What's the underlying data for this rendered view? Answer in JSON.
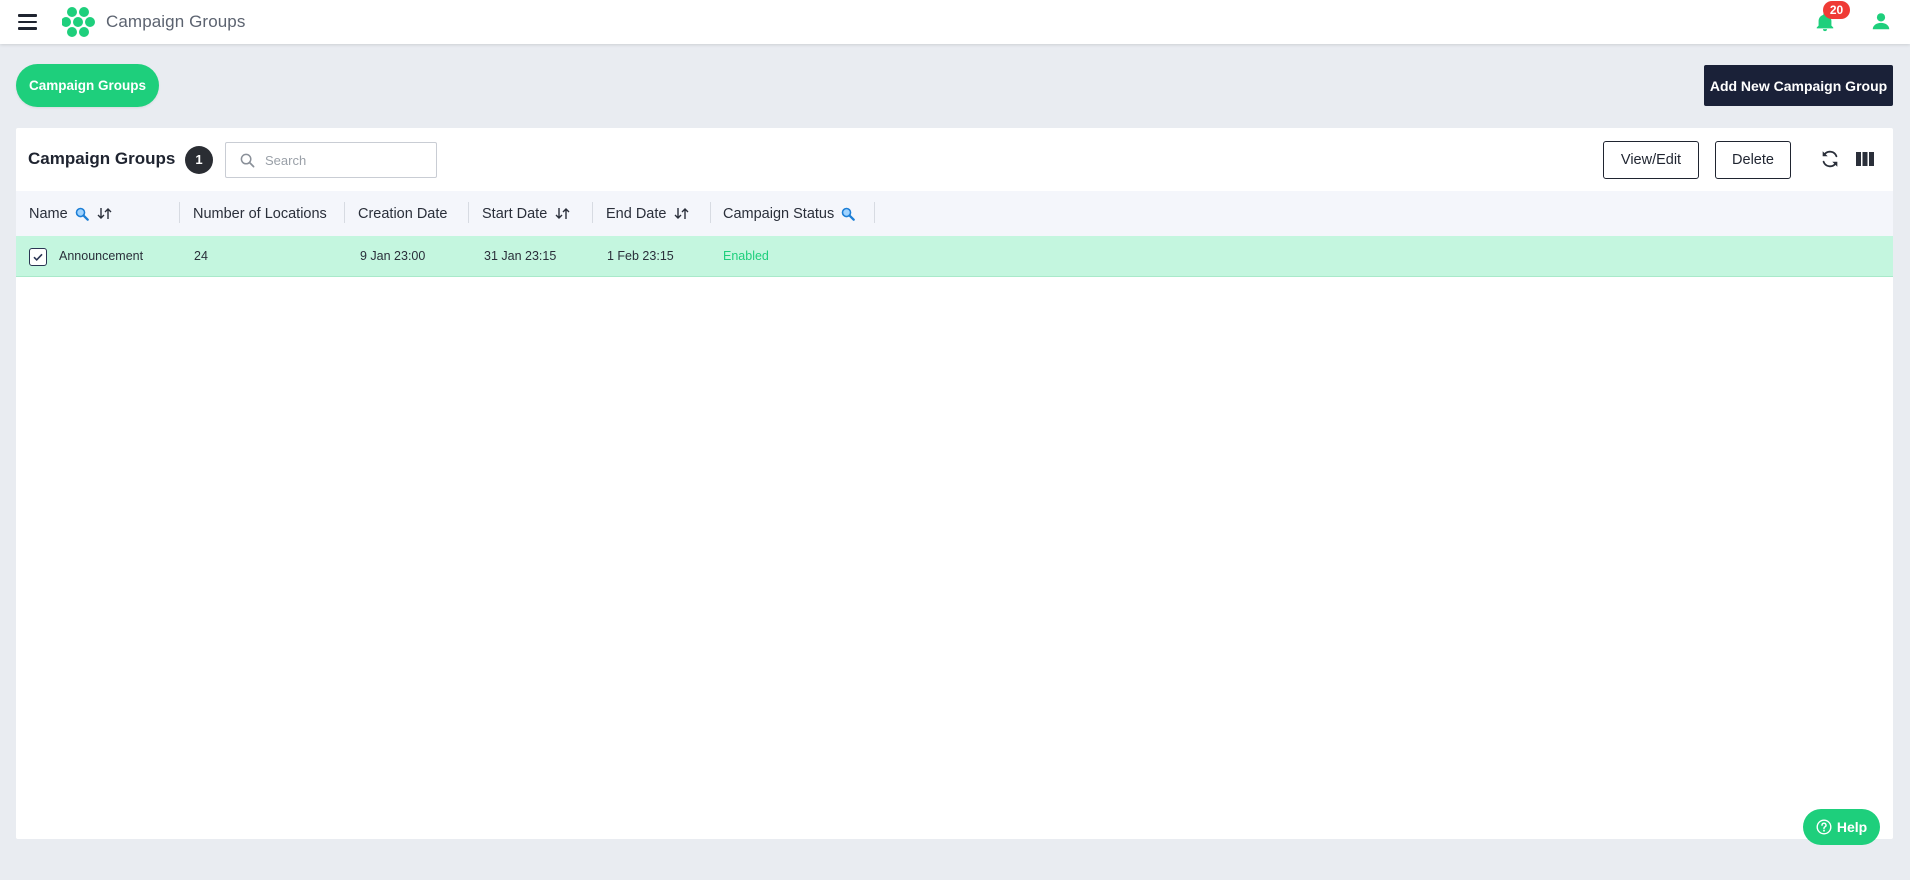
{
  "header": {
    "app_title": "Campaign Groups",
    "notification_count": "20"
  },
  "actions": {
    "pill_label": "Campaign Groups",
    "add_label": "Add New Campaign Group"
  },
  "card": {
    "title": "Campaign Groups",
    "count": "1",
    "search_placeholder": "Search",
    "search_value": "",
    "view_edit_label": "View/Edit",
    "delete_label": "Delete"
  },
  "table": {
    "columns": [
      "Name",
      "Number of Locations",
      "Creation Date",
      "Start Date",
      "End Date",
      "Campaign Status"
    ],
    "rows": [
      {
        "selected": true,
        "name": "Announcement",
        "locations": "24",
        "creation_date": "9 Jan 23:00",
        "start_date": "31 Jan 23:15",
        "end_date": "1 Feb 23:15",
        "status": "Enabled"
      }
    ]
  },
  "help": {
    "label": "Help"
  },
  "colors": {
    "accent_green": "#1ecf7c",
    "dark_navy": "#1a2138",
    "selected_row": "#c4f6df",
    "badge_red": "#ef3b35"
  },
  "icons": [
    "hamburger-menu-icon",
    "hexagon-logo-icon",
    "bell-icon",
    "user-icon",
    "search-icon",
    "refresh-icon",
    "columns-icon",
    "sort-icon",
    "filter-search-icon",
    "check-icon",
    "help-circle-icon"
  ]
}
